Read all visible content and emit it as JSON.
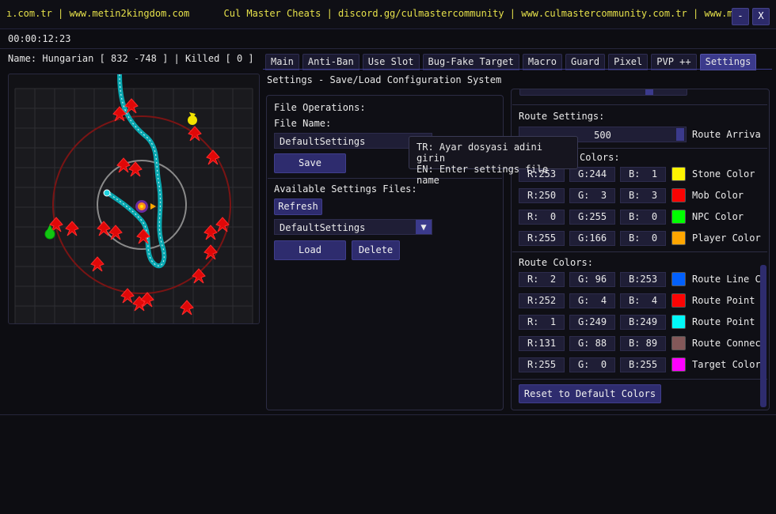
{
  "titlebar": {
    "marquee": "ı.com.tr | www.metin2kingdom.com      Cul Master Cheats | discord.gg/culmastercommunity | www.culmastercommunity.com.tr | www.me",
    "minimize_label": "-",
    "close_label": "X"
  },
  "timer": "00:00:12:23",
  "status_line": "Name: Hungarian [ 832 -748 ] | Killed [ 0 ]",
  "tabs": [
    "Main",
    "Anti-Ban",
    "Use Slot",
    "Bug-Fake Target",
    "Macro",
    "Guard",
    "Pixel",
    "PVP ++",
    "Settings"
  ],
  "active_tab": "Settings",
  "section_title": "Settings - Save/Load Configuration System",
  "file_ops": {
    "heading": "File Operations:",
    "file_name_label": "File Name:",
    "file_name_value": "DefaultSettings",
    "save_label": "Save",
    "available_label": "Available Settings Files:",
    "refresh_label": "Refresh",
    "selected_file": "DefaultSettings",
    "load_label": "Load",
    "delete_label": "Delete"
  },
  "tooltip": {
    "line1": "TR: Ayar dosyasi adini girin",
    "line2": "EN: Enter settings file name"
  },
  "route_settings": {
    "heading": "Route Settings:",
    "slider_value": "500",
    "slider_label": "Route Arriva"
  },
  "colors_heading": "Colors:",
  "entity_colors": [
    {
      "r": "R:253",
      "g": "G:244",
      "b": "B:  1",
      "label": "Stone Color",
      "hex": "#fdf401"
    },
    {
      "r": "R:250",
      "g": "G:  3",
      "b": "B:  3",
      "label": "Mob Color",
      "hex": "#fa0303"
    },
    {
      "r": "R:  0",
      "g": "G:255",
      "b": "B:  0",
      "label": "NPC Color",
      "hex": "#00ff00"
    },
    {
      "r": "R:255",
      "g": "G:166",
      "b": "B:  0",
      "label": "Player Color",
      "hex": "#ffa600"
    }
  ],
  "route_colors_heading": "Route Colors:",
  "route_colors": [
    {
      "r": "R:  2",
      "g": "G: 96",
      "b": "B:253",
      "label": "Route Line C",
      "hex": "#0260fd"
    },
    {
      "r": "R:252",
      "g": "G:  4",
      "b": "B:  4",
      "label": "Route Point",
      "hex": "#fc0404"
    },
    {
      "r": "R:  1",
      "g": "G:249",
      "b": "B:249",
      "label": "Route Point",
      "hex": "#01f9f9"
    },
    {
      "r": "R:131",
      "g": "G: 88",
      "b": "B: 89",
      "label": "Route Connec",
      "hex": "#835859"
    },
    {
      "r": "R:255",
      "g": "G:  0",
      "b": "B:255",
      "label": "Target Color",
      "hex": "#ff00ff"
    }
  ],
  "reset_label": "Reset to Default Colors",
  "icons": {
    "dropdown": "triangle-down-icon",
    "minimize": "minimize-icon",
    "close": "close-icon"
  },
  "accent": "#3b3a8c"
}
